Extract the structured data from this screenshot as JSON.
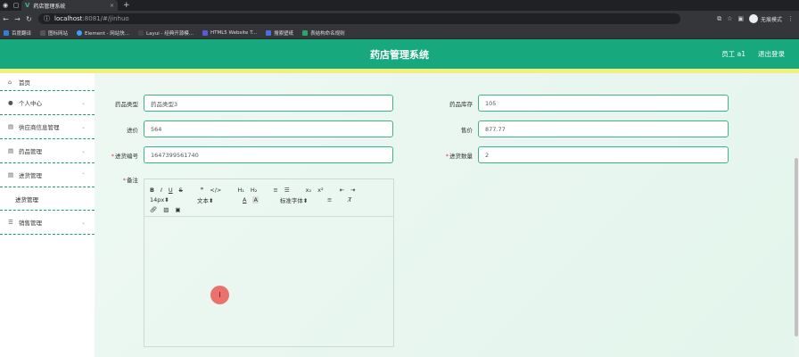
{
  "browser": {
    "tab_title": "药店管理系统",
    "address_host": "localhost",
    "address_path": ":8081/#/jinhuo",
    "incognito_label": "无痕模式",
    "bookmarks": [
      {
        "label": "百度翻译",
        "color": "#3a7bd5"
      },
      {
        "label": "图标网站",
        "color": "#555555"
      },
      {
        "label": "Element - 网站快...",
        "color": "#409eff"
      },
      {
        "label": "Layui - 经典开源模...",
        "color": "#444444"
      },
      {
        "label": "HTML5 Website T...",
        "color": "#5b5bd6"
      },
      {
        "label": "搜索壁纸",
        "color": "#4a6ee0"
      },
      {
        "label": "表结构命名规则",
        "color": "#2fa36b"
      }
    ]
  },
  "header": {
    "title": "药店管理系统",
    "user": "员工 a1",
    "logout": "退出登录",
    "brand_color": "#17a87e"
  },
  "sidebar": {
    "items": [
      {
        "label": "首页",
        "icon": "home-icon"
      },
      {
        "label": "个人中心",
        "icon": "user-icon"
      },
      {
        "label": "供应商信息管理",
        "icon": "list-icon"
      },
      {
        "label": "药品管理",
        "icon": "list-icon"
      },
      {
        "label": "进货管理",
        "icon": "list-icon"
      },
      {
        "label": "进货管理"
      },
      {
        "label": "销售管理",
        "icon": "menu-icon"
      }
    ]
  },
  "form": {
    "type_label": "药品类型",
    "type_value": "药品类型3",
    "stock_label": "药品库存",
    "stock_value": "105",
    "cost_label": "进价",
    "cost_value": "564",
    "price_label": "售价",
    "price_value": "877.77",
    "code_label": "进货编号",
    "code_value": "1647399561740",
    "qty_label": "进货数量",
    "qty_value": "2",
    "remark_label": "备注"
  },
  "editor": {
    "row1": [
      "B",
      "I",
      "U",
      "S",
      "❞",
      "</>",
      "H₁",
      "H₂",
      "≡",
      "☰",
      "x₂",
      "x²",
      "⇤",
      "⇥"
    ],
    "font_size": "14px",
    "text_style": "文本",
    "font_family": "标准字体",
    "row2_tail": [
      "A",
      "A",
      "≡",
      "T̸"
    ]
  },
  "cursor_glyph": "I"
}
